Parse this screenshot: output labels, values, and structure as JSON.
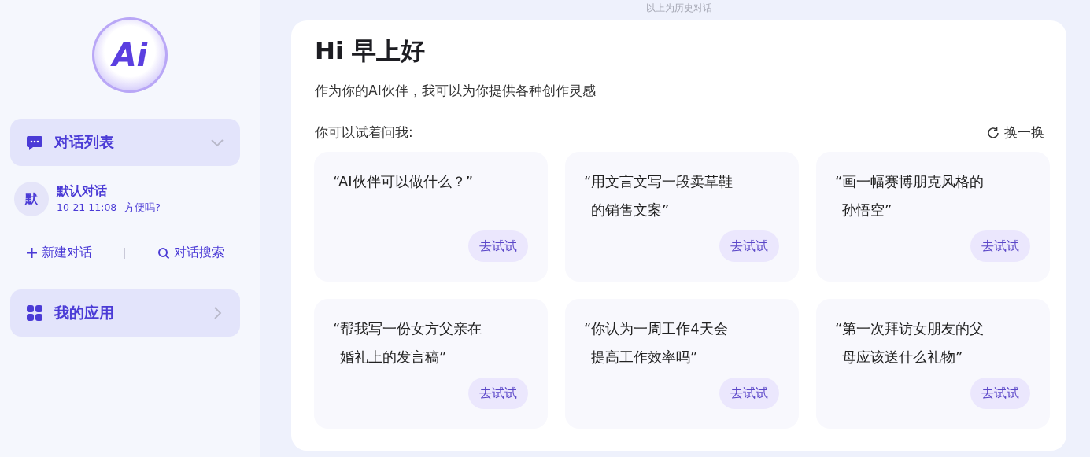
{
  "history_note": "以上为历史对话",
  "sidebar": {
    "logo_text": "Ai",
    "sections": [
      {
        "kind": "list",
        "title": "对话列表",
        "expanded": true
      },
      {
        "kind": "apps",
        "title": "我的应用",
        "expanded": false
      }
    ],
    "conversations": [
      {
        "avatar": "默",
        "title": "默认对话",
        "time": "10-21 11:08",
        "preview": "方便吗?"
      }
    ],
    "actions": [
      {
        "kind": "new",
        "label": "新建对话"
      },
      {
        "kind": "search",
        "label": "对话搜索"
      }
    ]
  },
  "welcome": {
    "greeting": "Hi 早上好",
    "subtitle": "作为你的AI伙伴，我可以为你提供各种创作灵感",
    "prompt_label": "你可以试着问我:",
    "refresh": "换一换",
    "suggestions": [
      {
        "text": "“AI伙伴可以做什么？”",
        "button": "去试试"
      },
      {
        "text": "“用文言文写一段卖草鞋的销售文案”",
        "button": "去试试"
      },
      {
        "text": "“画一幅赛博朋克风格的孙悟空”",
        "button": "去试试"
      },
      {
        "text": "“帮我写一份女方父亲在婚礼上的发言稿”",
        "button": "去试试"
      },
      {
        "text": "“你认为一周工作4天会提高工作效率吗”",
        "button": "去试试"
      },
      {
        "text": "“第一次拜访女朋友的父母应该送什么礼物”",
        "button": "去试试"
      }
    ]
  }
}
